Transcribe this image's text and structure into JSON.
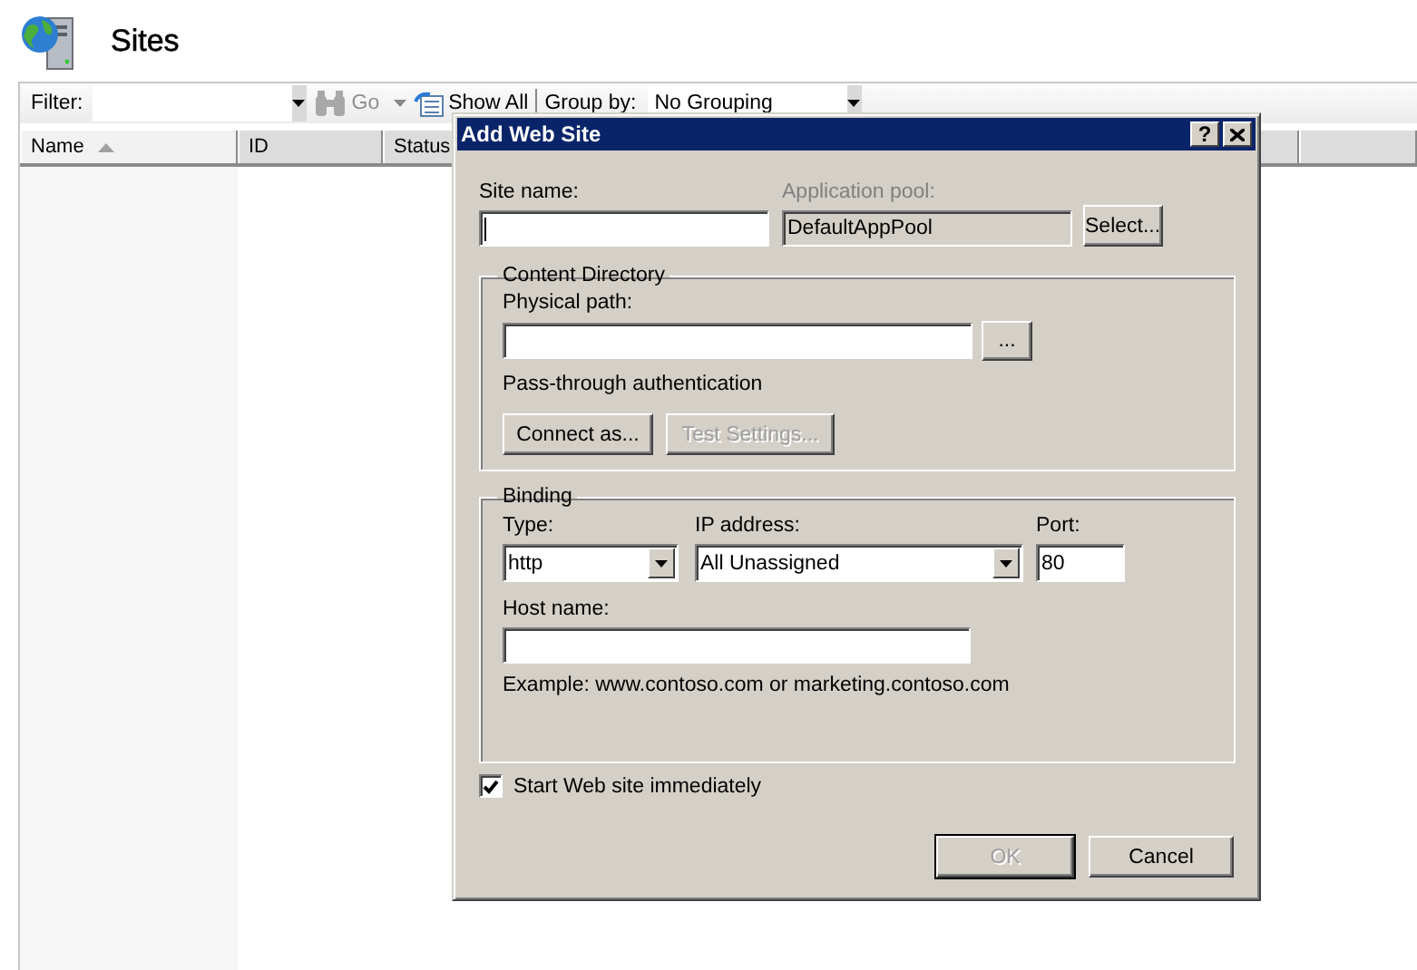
{
  "header": {
    "title": "Sites"
  },
  "toolbar": {
    "filter_label": "Filter:",
    "go": {
      "label": "Go",
      "disabled": true
    },
    "show_all": "Show All",
    "group_by_label": "Group by:",
    "group_by_value": "No Grouping"
  },
  "columns": [
    {
      "label": "Name",
      "sorted": true
    },
    {
      "label": "ID",
      "sorted": false
    },
    {
      "label": "Status",
      "sorted": false
    }
  ],
  "dialog": {
    "title": "Add Web Site",
    "help": "?",
    "site_name": {
      "label": "Site name:"
    },
    "app_pool": {
      "label": "Application pool:",
      "value": "DefaultAppPool",
      "disabled": true
    },
    "select_button": {
      "label": "Select...",
      "disabled": false
    },
    "content_directory": {
      "title": "Content Directory",
      "path_label": "Physical path:",
      "browse_button": "...",
      "auth_text": "Pass-through authentication",
      "buttons": [
        {
          "label": "Connect as...",
          "disabled": false
        },
        {
          "label": "Test Settings...",
          "disabled": true
        }
      ]
    },
    "binding": {
      "title": "Binding",
      "type_label": "Type:",
      "type_value": "http",
      "ip_label": "IP address:",
      "ip_value": "All Unassigned",
      "port_label": "Port:",
      "port_value": "80",
      "host_label": "Host name:",
      "example": "Example: www.contoso.com or marketing.contoso.com"
    },
    "start_checkbox": {
      "label": "Start Web site immediately",
      "checked": true
    },
    "buttons": [
      {
        "label": "OK",
        "disabled": true,
        "default": true
      },
      {
        "label": "Cancel",
        "disabled": false,
        "default": false
      }
    ]
  }
}
